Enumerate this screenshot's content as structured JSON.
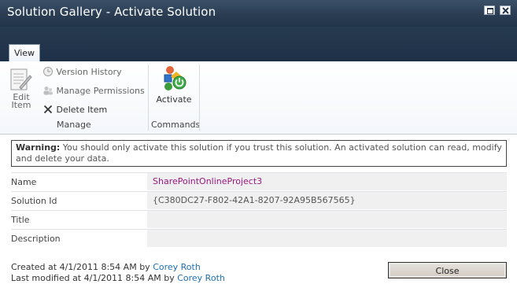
{
  "window": {
    "title": "Solution Gallery - Activate Solution"
  },
  "ribbon": {
    "tab_view": "View",
    "edit_item_line1": "Edit",
    "edit_item_line2": "Item",
    "version_history": "Version History",
    "manage_permissions": "Manage Permissions",
    "delete_item": "Delete Item",
    "group_manage": "Manage",
    "activate": "Activate",
    "group_commands": "Commands"
  },
  "warning": {
    "label": "Warning:",
    "text": " You should only activate this solution if you trust this solution. An activated solution can read, modify and delete your data."
  },
  "properties": [
    {
      "label": "Name",
      "value": "SharePointOnlineProject3"
    },
    {
      "label": "Solution Id",
      "value": "{C380DC27-F802-42A1-8207-92A95B567565}"
    },
    {
      "label": "Title",
      "value": ""
    },
    {
      "label": "Description",
      "value": ""
    }
  ],
  "meta": {
    "created_prefix": "Created at 4/1/2011 8:54 AM  by ",
    "created_by": "Corey Roth",
    "modified_prefix": "Last modified at 4/1/2011 8:54 AM  by ",
    "modified_by": "Corey Roth"
  },
  "buttons": {
    "close": "Close"
  },
  "colors": {
    "titlebar": "#2a3d53",
    "link_value": "#99177f",
    "user_link": "#1f6fb2"
  }
}
